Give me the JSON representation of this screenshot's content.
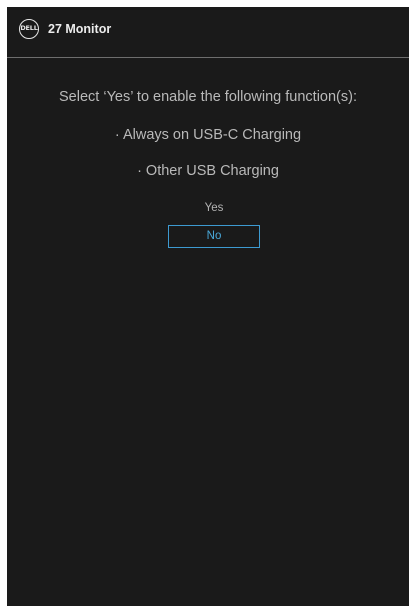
{
  "header": {
    "logo_text": "DELL",
    "title": "27 Monitor"
  },
  "dialog": {
    "prompt": "Select ‘Yes’ to enable the following function(s):",
    "functions": [
      "· Always on USB-C Charging",
      "· Other USB Charging"
    ],
    "options": [
      {
        "label": "Yes",
        "selected": false
      },
      {
        "label": "No",
        "selected": true
      }
    ]
  },
  "colors": {
    "background": "#1a1a1a",
    "text": "#b9b9b9",
    "accent": "#3d9ad1"
  }
}
